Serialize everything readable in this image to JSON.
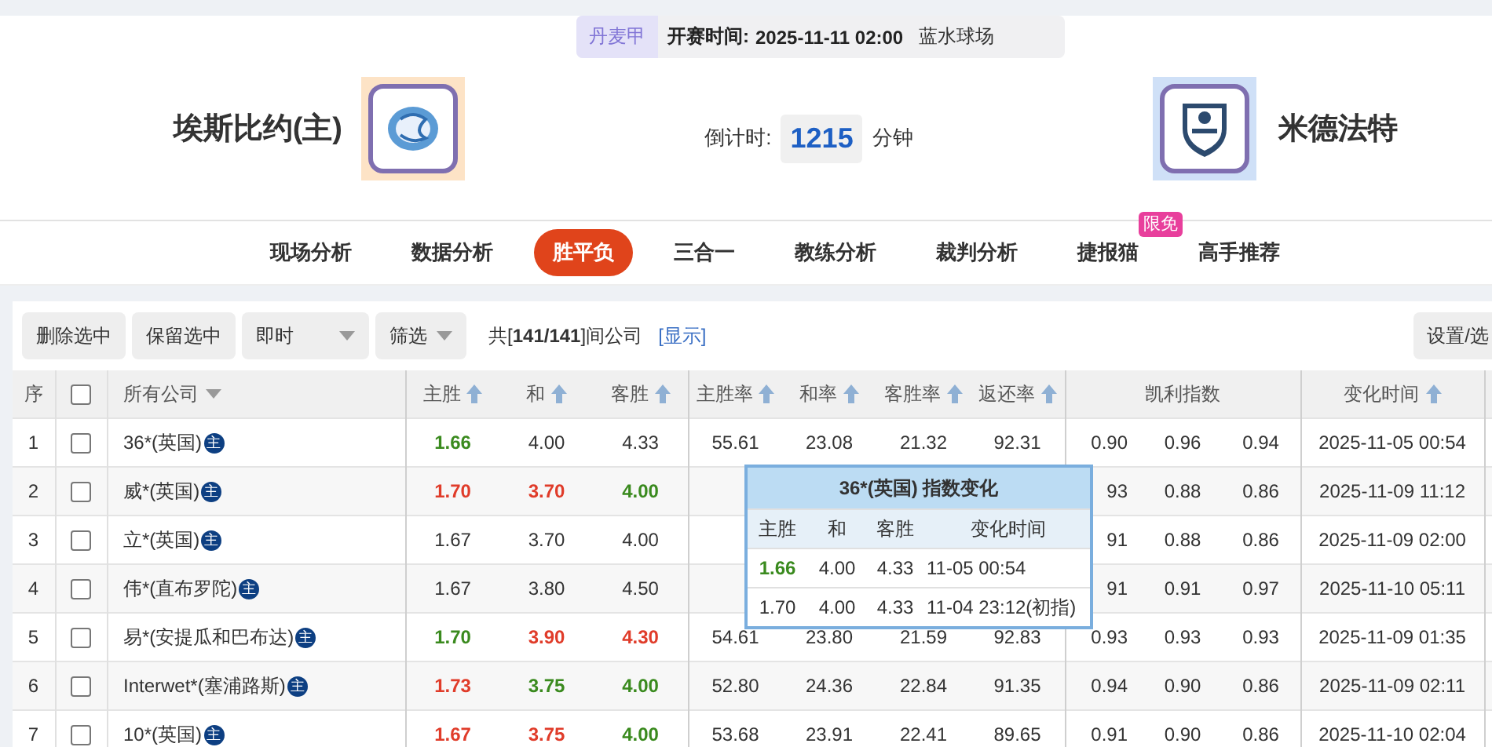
{
  "match": {
    "league": "丹麦甲",
    "kickoff_label": "开赛时间:",
    "kickoff": "2025-11-11 02:00",
    "venue": "蓝水球场",
    "home": {
      "name": "埃斯比约(主)"
    },
    "away": {
      "name": "米德法特"
    },
    "countdown": {
      "label": "倒计时:",
      "value": "1215",
      "unit": "分钟"
    }
  },
  "nav": [
    {
      "label": "现场分析",
      "selected": false
    },
    {
      "label": "数据分析",
      "selected": false
    },
    {
      "label": "胜平负",
      "selected": true
    },
    {
      "label": "三合一",
      "selected": false
    },
    {
      "label": "教练分析",
      "selected": false
    },
    {
      "label": "裁判分析",
      "selected": false
    },
    {
      "label": "捷报猫",
      "selected": false,
      "badge": "限免"
    },
    {
      "label": "高手推荐",
      "selected": false
    }
  ],
  "toolbar": {
    "buttons": [
      "删除选中",
      "保留选中"
    ],
    "dropdowns": [
      "即时",
      "筛选"
    ],
    "summary": "共[**141/141**]间公司",
    "link": "[显示]",
    "settings": "设置/选"
  },
  "columns": {
    "seq": "序",
    "select_all_checked": false,
    "company": "所有公司",
    "odds": [
      "主胜",
      "和",
      "客胜"
    ],
    "rates": [
      "主胜率",
      "和率",
      "客胜率",
      "返还率"
    ],
    "kelly": "凯利指数",
    "time": "变化时间"
  },
  "rows": [
    {
      "seq": "1",
      "checked": false,
      "company": "36*(英国)",
      "badge": "主",
      "odds": [
        {
          "value": "1.66",
          "color": "#3a8a1e"
        },
        {
          "value": "4.00",
          "color": "#333333"
        },
        {
          "value": "4.33",
          "color": "#333333"
        }
      ],
      "rates": [
        "55.61",
        "23.08",
        "21.32",
        "92.31"
      ],
      "kelly": [
        "0.90",
        "0.96",
        "0.94"
      ],
      "time": "2025-11-05 00:54"
    },
    {
      "seq": "2",
      "checked": false,
      "company": "威*(英国)",
      "badge": "主",
      "odds": [
        {
          "value": "1.70",
          "color": "#e03c2a"
        },
        {
          "value": "3.70",
          "color": "#e03c2a"
        },
        {
          "value": "4.00",
          "color": "#3a8a1e"
        }
      ],
      "kelly": [
        "93",
        "0.88",
        "0.86"
      ],
      "time": "2025-11-09 11:12"
    },
    {
      "seq": "3",
      "checked": false,
      "company": "立*(英国)",
      "badge": "主",
      "odds": [
        {
          "value": "1.67",
          "color": "#333333"
        },
        {
          "value": "3.70",
          "color": "#333333"
        },
        {
          "value": "4.00",
          "color": "#333333"
        }
      ],
      "kelly": [
        "91",
        "0.88",
        "0.86"
      ],
      "time": "2025-11-09 02:00"
    },
    {
      "seq": "4",
      "checked": false,
      "company": "伟*(直布罗陀)",
      "badge": "主",
      "odds": [
        {
          "value": "1.67",
          "color": "#333333"
        },
        {
          "value": "3.80",
          "color": "#333333"
        },
        {
          "value": "4.50",
          "color": "#333333"
        }
      ],
      "kelly": [
        "91",
        "0.91",
        "0.97"
      ],
      "time": "2025-11-10 05:11"
    },
    {
      "seq": "5",
      "checked": false,
      "company": "易*(安提瓜和巴布达)",
      "badge": "主",
      "odds": [
        {
          "value": "1.70",
          "color": "#3a8a1e"
        },
        {
          "value": "3.90",
          "color": "#e03c2a"
        },
        {
          "value": "4.30",
          "color": "#e03c2a"
        }
      ],
      "rates": [
        "54.61",
        "23.80",
        "21.59",
        "92.83"
      ],
      "kelly": [
        "0.93",
        "0.93",
        "0.93"
      ],
      "time": "2025-11-09 01:35"
    },
    {
      "seq": "6",
      "checked": false,
      "company": "Interwet*(塞浦路斯)",
      "badge": "主",
      "odds": [
        {
          "value": "1.73",
          "color": "#e03c2a"
        },
        {
          "value": "3.75",
          "color": "#3a8a1e"
        },
        {
          "value": "4.00",
          "color": "#3a8a1e"
        }
      ],
      "rates": [
        "52.80",
        "24.36",
        "22.84",
        "91.35"
      ],
      "kelly": [
        "0.94",
        "0.90",
        "0.86"
      ],
      "time": "2025-11-09 02:11"
    },
    {
      "seq": "7",
      "checked": false,
      "company": "10*(英国)",
      "badge": "主",
      "odds": [
        {
          "value": "1.67",
          "color": "#e03c2a"
        },
        {
          "value": "3.75",
          "color": "#e03c2a"
        },
        {
          "value": "4.00",
          "color": "#3a8a1e"
        }
      ],
      "rates": [
        "53.68",
        "23.91",
        "22.41",
        "89.65"
      ],
      "kelly": [
        "0.91",
        "0.90",
        "0.86"
      ],
      "time": "2025-11-10 02:04"
    }
  ],
  "popup": {
    "title": "36*(英国) 指数变化",
    "columns": [
      "主胜",
      "和",
      "客胜",
      "变化时间"
    ],
    "rows": [
      {
        "odds": [
          {
            "value": "1.66",
            "color": "#3a8a1e"
          },
          {
            "value": "4.00",
            "color": "#333333"
          },
          {
            "value": "4.33",
            "color": "#333333"
          }
        ],
        "time": "11-05 00:54"
      },
      {
        "odds": [
          {
            "value": "1.70",
            "color": "#333333"
          },
          {
            "value": "4.00",
            "color": "#333333"
          },
          {
            "value": "4.33",
            "color": "#333333"
          }
        ],
        "time": "11-04 23:12(初指)"
      }
    ]
  }
}
